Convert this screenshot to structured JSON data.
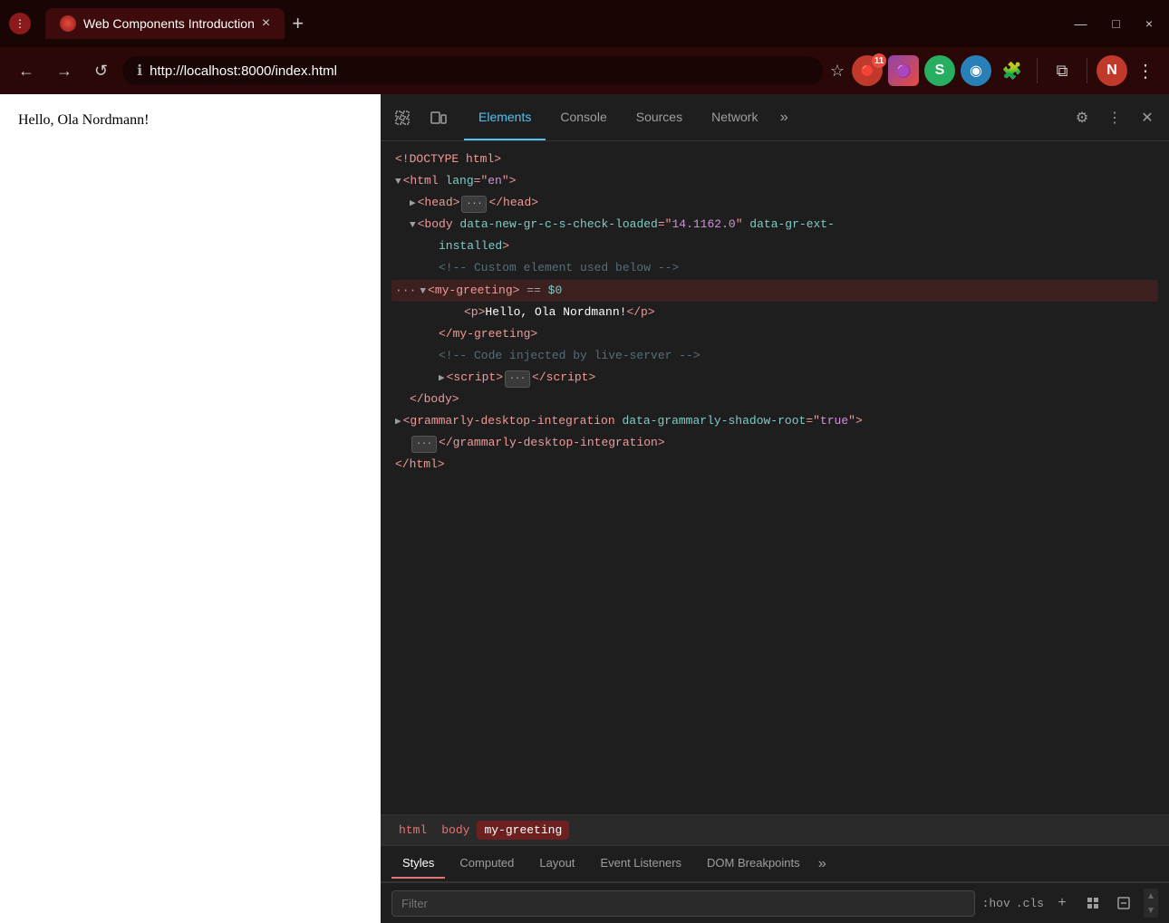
{
  "browser": {
    "tab_title": "Web Components Introduction",
    "tab_close": "×",
    "new_tab": "+",
    "win_minimize": "—",
    "win_maximize": "□",
    "win_close": "×",
    "back": "←",
    "forward": "→",
    "reload": "↺",
    "address": "http://localhost:8000/index.html",
    "address_bold": "localhost:8000/index.html",
    "address_scheme": "http://",
    "star": "☆",
    "badge_num": "11"
  },
  "page": {
    "content": "Hello, Ola Nordmann!"
  },
  "devtools": {
    "tabs": [
      {
        "label": "Elements",
        "active": true
      },
      {
        "label": "Console",
        "active": false
      },
      {
        "label": "Sources",
        "active": false
      },
      {
        "label": "Network",
        "active": false
      },
      {
        "label": "»",
        "active": false
      }
    ],
    "dom": {
      "lines": [
        {
          "indent": 0,
          "content": "<!DOCTYPE html>",
          "type": "doctype"
        },
        {
          "indent": 0,
          "content": "<html lang=\"en\">",
          "type": "open-tag"
        },
        {
          "indent": 1,
          "content": "<head>",
          "type": "collapsed",
          "has_dots": true
        },
        {
          "indent": 1,
          "content": "<body data-new-gr-c-s-check-loaded=\"14.1162.0\" data-gr-ext-installed>",
          "type": "open-tag-long"
        },
        {
          "indent": 2,
          "content": "<!-- Custom element used below -->",
          "type": "comment"
        },
        {
          "indent": 2,
          "content": "<my-greeting> == $0",
          "type": "selected-tag"
        },
        {
          "indent": 3,
          "content": "<p>Hello, Ola Nordmann!</p>",
          "type": "tag-with-text"
        },
        {
          "indent": 2,
          "content": "</my-greeting>",
          "type": "close-tag"
        },
        {
          "indent": 2,
          "content": "<!-- Code injected by live-server -->",
          "type": "comment"
        },
        {
          "indent": 2,
          "content": "<script>",
          "type": "collapsed-script",
          "has_dots": true
        },
        {
          "indent": 1,
          "content": "</body>",
          "type": "close-tag"
        },
        {
          "indent": 0,
          "content": "<grammarly-desktop-integration data-grammarly-shadow-root=\"true\">",
          "type": "open-tag-grammarly"
        },
        {
          "indent": 1,
          "content": "</grammarly-desktop-integration>",
          "type": "close-tag-grammarly",
          "has_dots": true
        },
        {
          "indent": 0,
          "content": "</html>",
          "type": "close-tag"
        }
      ]
    },
    "breadcrumb": [
      "html",
      "body",
      "my-greeting"
    ],
    "breadcrumb_selected": "my-greeting",
    "bottom_tabs": [
      "Styles",
      "Computed",
      "Layout",
      "Event Listeners",
      "DOM Breakpoints",
      "»"
    ],
    "bottom_tab_active": "Styles",
    "filter_placeholder": "Filter",
    "filter_actions": [
      ":hov",
      ".cls",
      "+"
    ]
  }
}
